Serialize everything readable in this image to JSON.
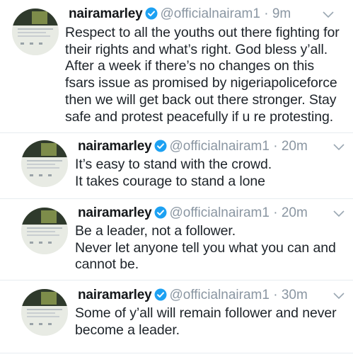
{
  "tweets": [
    {
      "display_name": "nairamarley",
      "handle": "@officialnairam1",
      "separator": "·",
      "time": "9m",
      "lines": [
        "Respect to all the youths out there fighting for",
        "their rights and what’s right. God bless y’all.",
        "After a week if there’s no changes on this",
        "fsars issue as promised by nigeriapoliceforce",
        "then we will get back out there stronger. Stay",
        "safe and protest peacefully if u re protesting."
      ]
    },
    {
      "display_name": "nairamarley",
      "handle": "@officialnairam1",
      "separator": "·",
      "time": "20m",
      "lines": [
        "It’s easy to stand with the crowd.",
        "It takes courage to stand a lone"
      ]
    },
    {
      "display_name": "nairamarley",
      "handle": "@officialnairam1",
      "separator": "·",
      "time": "20m",
      "lines": [
        "Be a leader, not a follower.",
        "Never let anyone tell you what you can and",
        "cannot be."
      ]
    },
    {
      "display_name": "nairamarley",
      "handle": "@officialnairam1",
      "separator": "·",
      "time": "30m",
      "lines": [
        "Some of y’all will remain follower and never",
        "become a leader."
      ]
    }
  ],
  "colors": {
    "verified_badge": "#1da1f2",
    "handle_gray": "#8a96a2",
    "divider": "#e6ecf0"
  },
  "icons": [
    "verified-badge-icon",
    "chevron-down-icon",
    "avatar"
  ]
}
